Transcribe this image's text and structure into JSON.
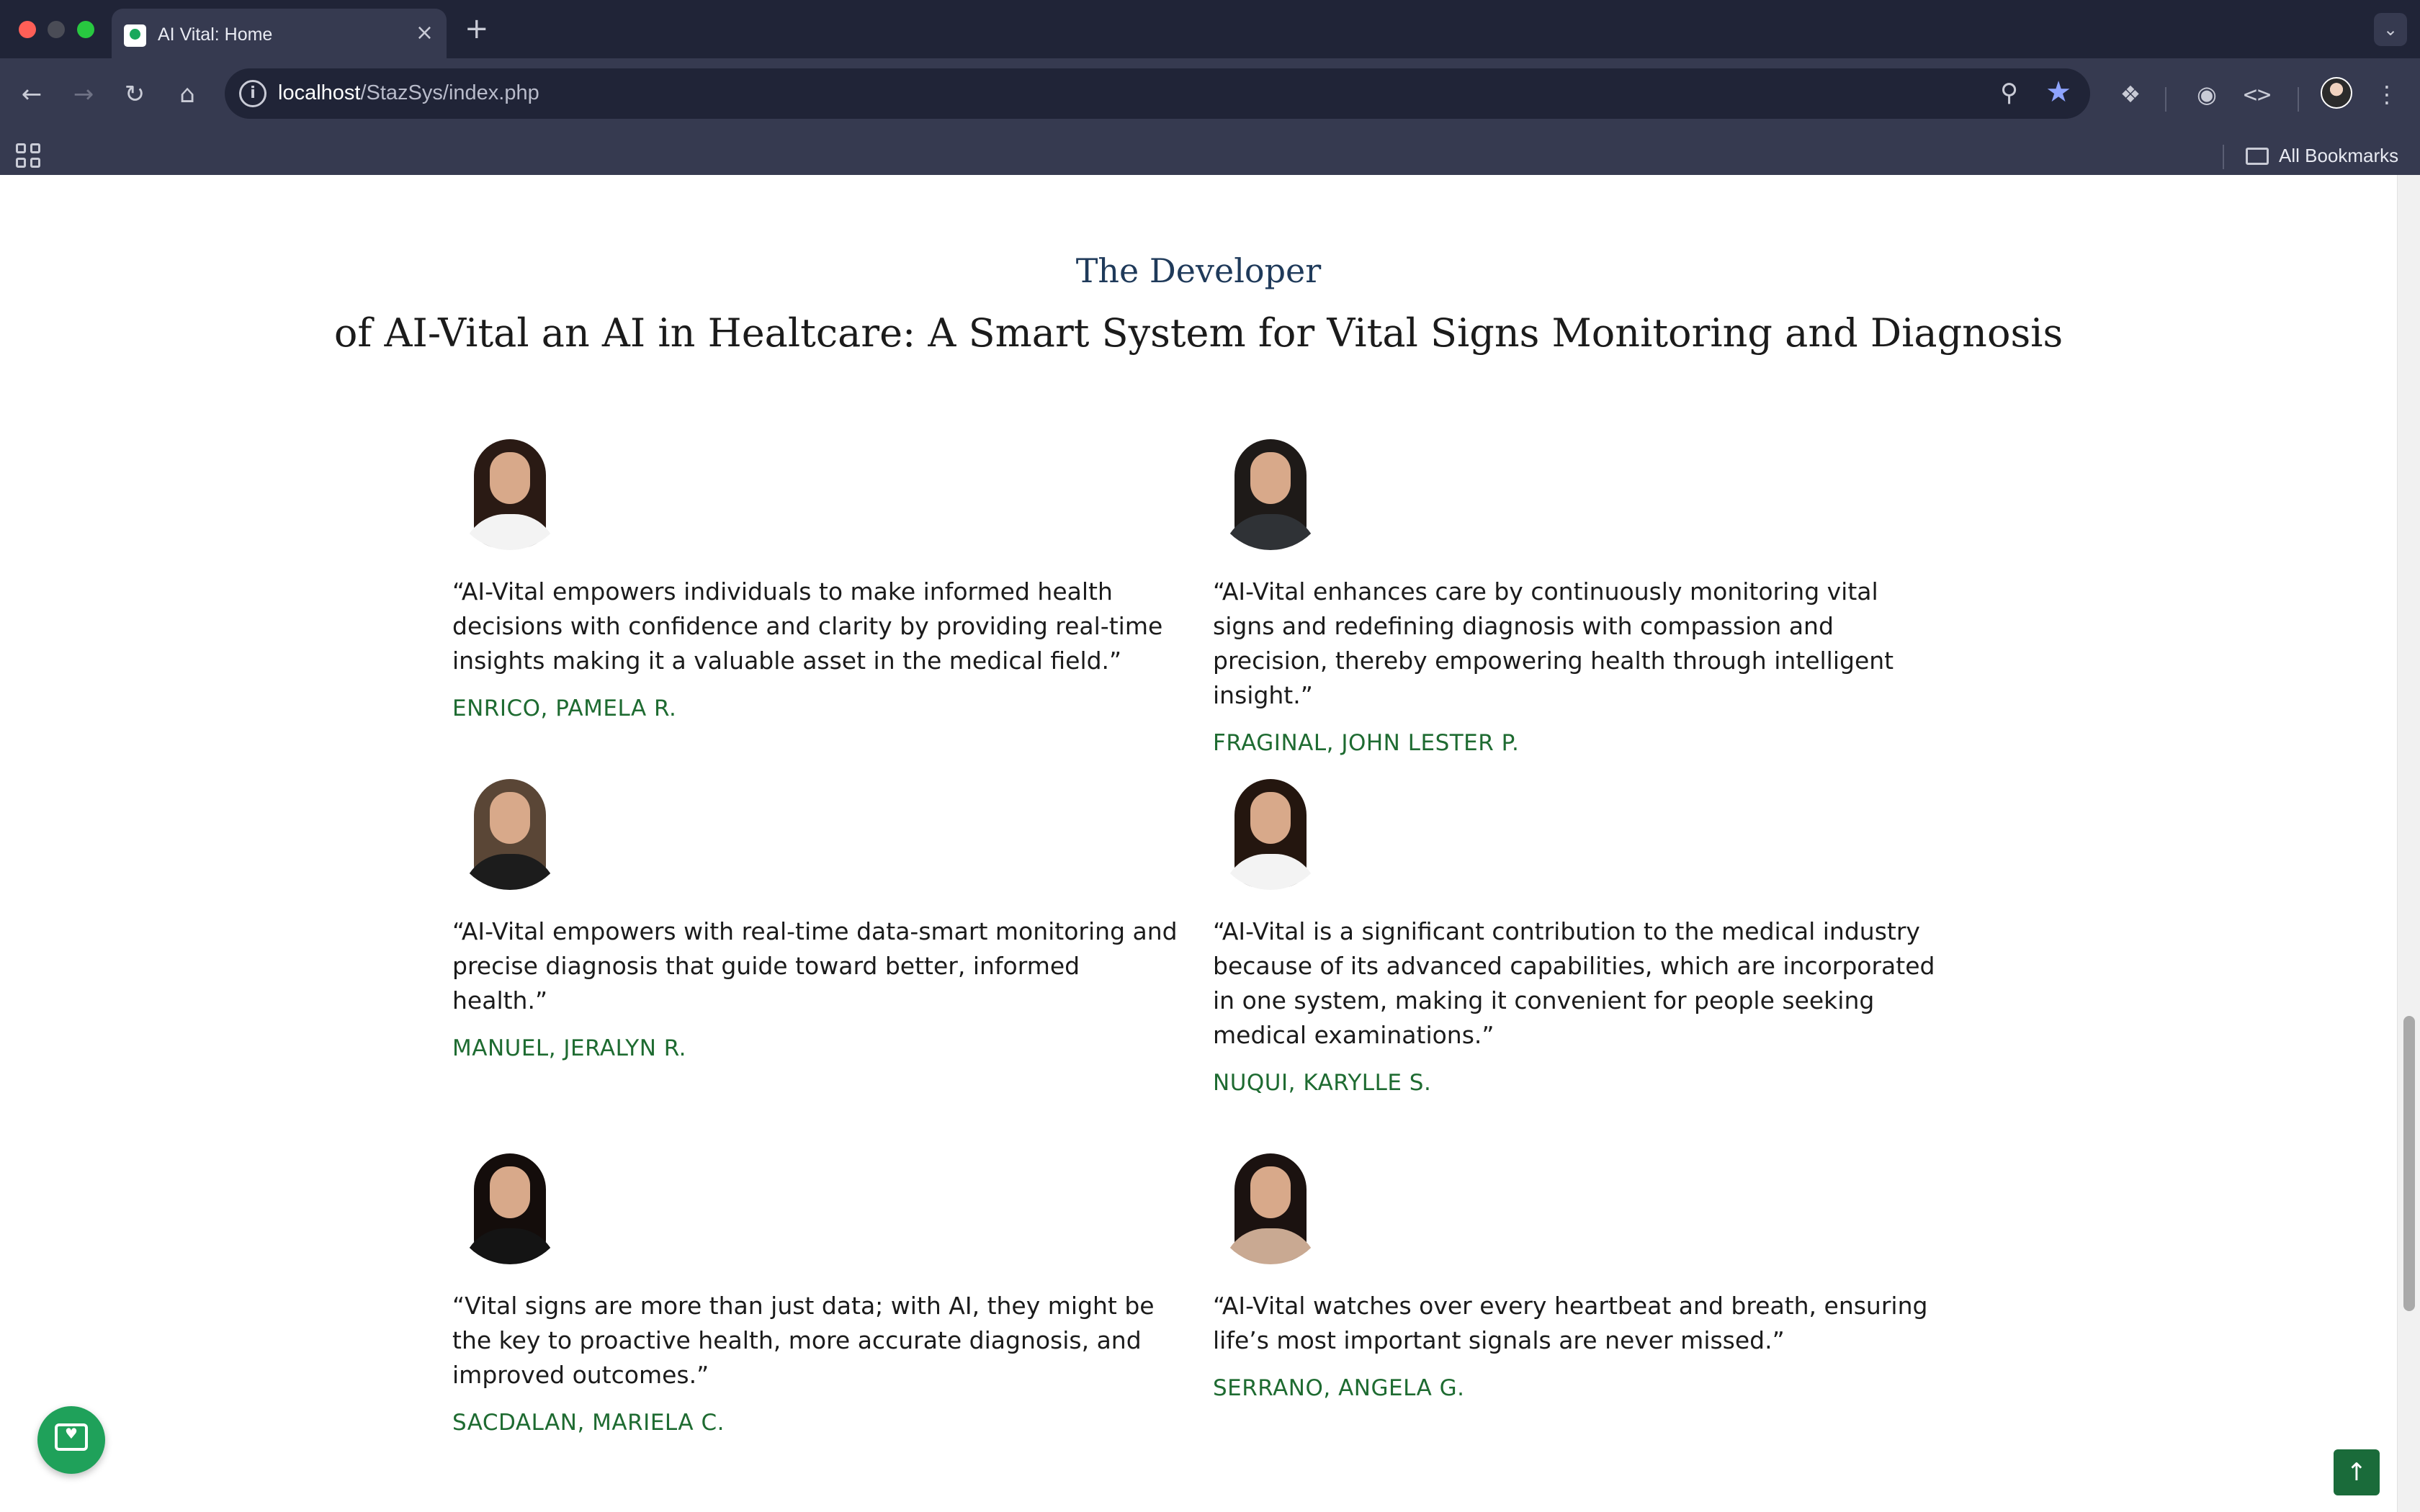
{
  "browser": {
    "tab_title": "AI Vital: Home",
    "tab_close": "×",
    "new_tab": "+",
    "url_host": "localhost",
    "url_path": "/StazSys/index.php",
    "bookmarks_label": "All Bookmarks"
  },
  "page": {
    "kicker": "The Developer",
    "title": "of AI-Vital an AI in Healtcare: A Smart System for Vital Signs Monitoring and Diagnosis"
  },
  "developers": [
    {
      "quote": "“AI-Vital empowers individuals to make informed health decisions with confidence and clarity by providing real-time insights making it a valuable asset in the medical field.”",
      "name": "ENRICO, PAMELA R.",
      "hair": "#2a1a14",
      "shirt": "#f3f3f3"
    },
    {
      "quote": "“AI-Vital enhances care by continuously monitoring vital signs and redefining diagnosis with compassion and precision, thereby empowering health through intelligent insight.”",
      "name": "FRAGINAL, JOHN LESTER P.",
      "hair": "#1e1a18",
      "shirt": "#2f3236"
    },
    {
      "quote": "“AI-Vital empowers with real-time data-smart monitoring and precise diagnosis that guide toward better, informed health.”",
      "name": "MANUEL, JERALYN R.",
      "hair": "#5a4636",
      "shirt": "#1c1c1c"
    },
    {
      "quote": "“AI-Vital is a significant contribution to the medical industry because of its advanced capabilities, which are incorporated in one system, making it convenient for people seeking medical examinations.”",
      "name": "NUQUI, KARYLLE S.",
      "hair": "#24160f",
      "shirt": "#f3f3f3"
    },
    {
      "quote": "“Vital signs are more than just data; with AI, they might be the key to proactive health, more accurate diagnosis, and improved outcomes.”",
      "name": "SACDALAN, MARIELA C.",
      "hair": "#140d0b",
      "shirt": "#141414"
    },
    {
      "quote": "“AI-Vital watches over every heartbeat and breath, ensuring life’s most important signals are never missed.”",
      "name": "SERRANO, ANGELA G.",
      "hair": "#1b1210",
      "shirt": "#c9a992"
    }
  ],
  "colors": {
    "name_green": "#1e6b31",
    "chat_button": "#1fa15a",
    "back_to_top": "#1a6b3a"
  },
  "icons": {
    "back_to_top": "↑",
    "chat": "♥"
  }
}
